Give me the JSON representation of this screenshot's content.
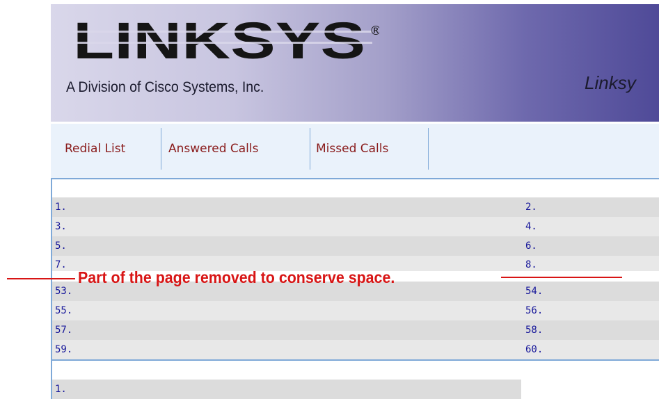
{
  "header": {
    "brand": "LINKSYS",
    "registered_mark": "®",
    "tagline": "A Division of Cisco Systems, Inc.",
    "title_partial": "Linksy"
  },
  "tabs": [
    {
      "label": "Redial List"
    },
    {
      "label": "Answered Calls"
    },
    {
      "label": "Missed Calls"
    }
  ],
  "list": {
    "rows_top": [
      {
        "left": "1.",
        "right": "2."
      },
      {
        "left": "3.",
        "right": "4."
      },
      {
        "left": "5.",
        "right": "6."
      },
      {
        "left": "7.",
        "right": "8."
      }
    ],
    "rows_bottom": [
      {
        "left": "53.",
        "right": "54."
      },
      {
        "left": "55.",
        "right": "56."
      },
      {
        "left": "57.",
        "right": "58."
      },
      {
        "left": "59.",
        "right": "60."
      }
    ],
    "next_section_first": "1."
  },
  "annotation": {
    "text": "Part of the page removed to conserve space.",
    "color": "#d81515"
  },
  "colors": {
    "accent_border": "#7fa9d8",
    "tab_text": "#8a1c1c",
    "list_text": "#17179a"
  }
}
